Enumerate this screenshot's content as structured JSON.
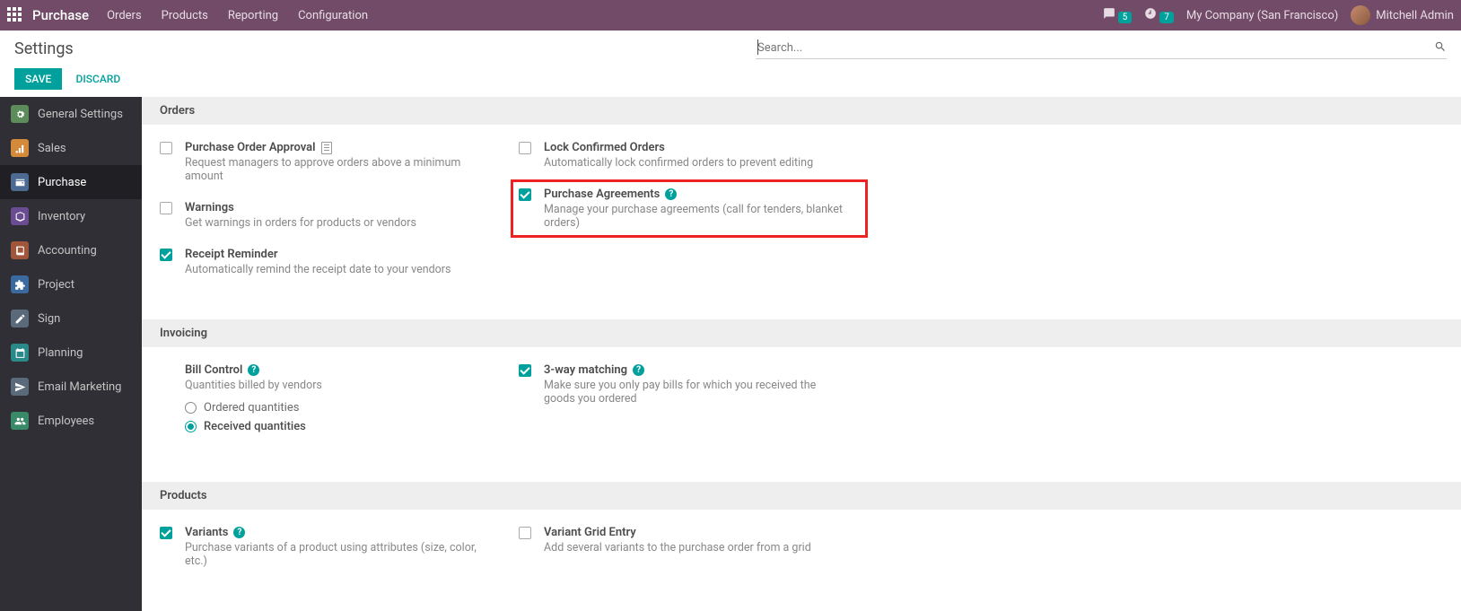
{
  "topnav": {
    "brand": "Purchase",
    "menu": [
      "Orders",
      "Products",
      "Reporting",
      "Configuration"
    ],
    "badge_messages": "5",
    "badge_activities": "7",
    "company": "My Company (San Francisco)",
    "user": "Mitchell Admin"
  },
  "control": {
    "title": "Settings",
    "search_placeholder": "Search...",
    "save": "SAVE",
    "discard": "DISCARD"
  },
  "sidebar": {
    "items": [
      {
        "label": "General Settings",
        "color": "#5b8c5a"
      },
      {
        "label": "Sales",
        "color": "#d38a3a"
      },
      {
        "label": "Purchase",
        "color": "#4c6a92",
        "active": true
      },
      {
        "label": "Inventory",
        "color": "#6a4c92"
      },
      {
        "label": "Accounting",
        "color": "#a0563a"
      },
      {
        "label": "Project",
        "color": "#3a6aa0"
      },
      {
        "label": "Sign",
        "color": "#5a6a7a"
      },
      {
        "label": "Planning",
        "color": "#2a8a8a"
      },
      {
        "label": "Email Marketing",
        "color": "#5a6a7a"
      },
      {
        "label": "Employees",
        "color": "#3a8a6a"
      }
    ]
  },
  "sections": {
    "orders": {
      "title": "Orders",
      "po_approval": {
        "label": "Purchase Order Approval",
        "desc": "Request managers to approve orders above a minimum amount",
        "checked": false
      },
      "warnings": {
        "label": "Warnings",
        "desc": "Get warnings in orders for products or vendors",
        "checked": false
      },
      "receipt": {
        "label": "Receipt Reminder",
        "desc": "Automatically remind the receipt date to your vendors",
        "checked": true
      },
      "lock": {
        "label": "Lock Confirmed Orders",
        "desc": "Automatically lock confirmed orders to prevent editing",
        "checked": false
      },
      "agreements": {
        "label": "Purchase Agreements",
        "desc": "Manage your purchase agreements (call for tenders, blanket orders)",
        "checked": true
      }
    },
    "invoicing": {
      "title": "Invoicing",
      "bill_control": {
        "label": "Bill Control",
        "desc": "Quantities billed by vendors"
      },
      "radio_ordered": "Ordered quantities",
      "radio_received": "Received quantities",
      "three_way": {
        "label": "3-way matching",
        "desc": "Make sure you only pay bills for which you received the goods you ordered",
        "checked": true
      }
    },
    "products": {
      "title": "Products",
      "variants": {
        "label": "Variants",
        "desc": "Purchase variants of a product using attributes (size, color, etc.)",
        "checked": true
      },
      "grid": {
        "label": "Variant Grid Entry",
        "desc": "Add several variants to the purchase order from a grid",
        "checked": false
      }
    }
  }
}
